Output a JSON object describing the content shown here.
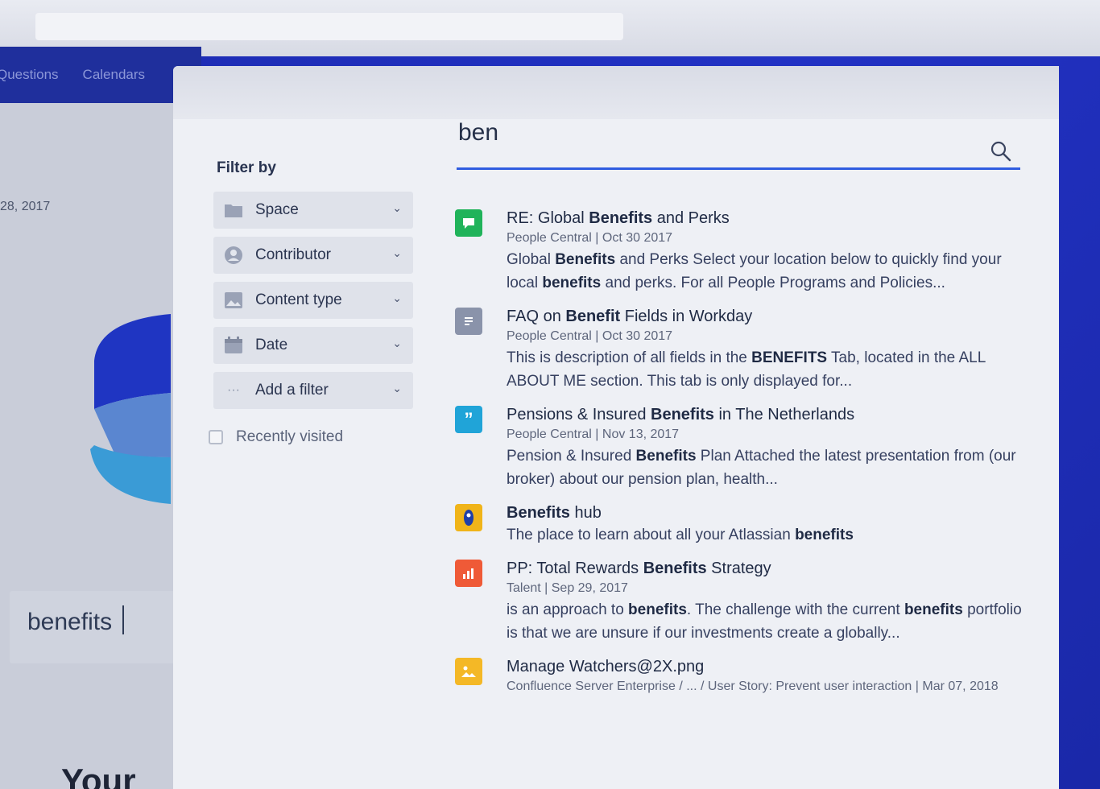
{
  "background_app": {
    "nav_items": [
      "Questions",
      "Calendars"
    ],
    "date_text": "28, 2017",
    "search_value": "benefits",
    "heading_fragment": "Your"
  },
  "search": {
    "query": "ben",
    "accent_color": "#2f5ce0"
  },
  "filters": {
    "title": "Filter by",
    "items": [
      {
        "label": "Space",
        "icon": "folder-icon"
      },
      {
        "label": "Contributor",
        "icon": "person-icon"
      },
      {
        "label": "Content type",
        "icon": "image-icon"
      },
      {
        "label": "Date",
        "icon": "calendar-icon"
      },
      {
        "label": "Add a filter",
        "icon": "more-icon"
      }
    ],
    "recently_visited": "Recently visited"
  },
  "results": [
    {
      "icon": "chat-icon",
      "icon_color": "#20b35a",
      "title_parts": [
        [
          "RE: Global ",
          false
        ],
        [
          "Benefits",
          true
        ],
        [
          " and Perks",
          false
        ]
      ],
      "meta": "People Central  |  Oct 30 2017",
      "desc_parts": [
        [
          "Global ",
          false
        ],
        [
          "Benefits",
          true
        ],
        [
          " and Perks Select your location below to quickly find your local ",
          false
        ],
        [
          "benefits",
          true
        ],
        [
          " and perks. For all People Programs and Policies...",
          false
        ]
      ]
    },
    {
      "icon": "document-icon",
      "icon_color": "#8a93aa",
      "title_parts": [
        [
          "FAQ on ",
          false
        ],
        [
          "Benefit",
          true
        ],
        [
          " Fields in Workday",
          false
        ]
      ],
      "meta": "People Central  |  Oct 30 2017",
      "desc_parts": [
        [
          "This is description of all fields in the ",
          false
        ],
        [
          "BENEFITS",
          true
        ],
        [
          " Tab, located in the ALL ABOUT ME section. This tab is only displayed for...",
          false
        ]
      ]
    },
    {
      "icon": "quote-icon",
      "icon_color": "#20a4d8",
      "title_parts": [
        [
          "Pensions & Insured ",
          false
        ],
        [
          "Benefits",
          true
        ],
        [
          " in The Netherlands",
          false
        ]
      ],
      "meta": "People Central  |  Nov 13, 2017",
      "desc_parts": [
        [
          "Pension & Insured ",
          false
        ],
        [
          "Benefits",
          true
        ],
        [
          " Plan Attached the latest presentation from (our broker) about our pension plan, health...",
          false
        ]
      ]
    },
    {
      "icon": "space-icon",
      "icon_color": "#f0b419",
      "title_parts": [
        [
          "Benefits",
          true
        ],
        [
          " hub",
          false
        ]
      ],
      "meta": "",
      "desc_parts": [
        [
          "The place to learn about all your Atlassian ",
          false
        ],
        [
          "benefits",
          true
        ]
      ]
    },
    {
      "icon": "chart-icon",
      "icon_color": "#ef5a37",
      "title_parts": [
        [
          "PP: Total Rewards ",
          false
        ],
        [
          "Benefits",
          true
        ],
        [
          " Strategy",
          false
        ]
      ],
      "meta": "Talent  |  Sep 29, 2017",
      "desc_parts": [
        [
          "is an approach to ",
          false
        ],
        [
          "benefits",
          true
        ],
        [
          ". The challenge with the current ",
          false
        ],
        [
          "benefits",
          true
        ],
        [
          " portfolio is that we are unsure if our investments create a globally...",
          false
        ]
      ]
    },
    {
      "icon": "image-file-icon",
      "icon_color": "#f4b826",
      "title_parts": [
        [
          "Manage Watchers@2X.png",
          false
        ]
      ],
      "meta": "Confluence Server Enterprise / ... / User Story: Prevent user interaction | Mar 07, 2018",
      "desc_parts": []
    }
  ]
}
